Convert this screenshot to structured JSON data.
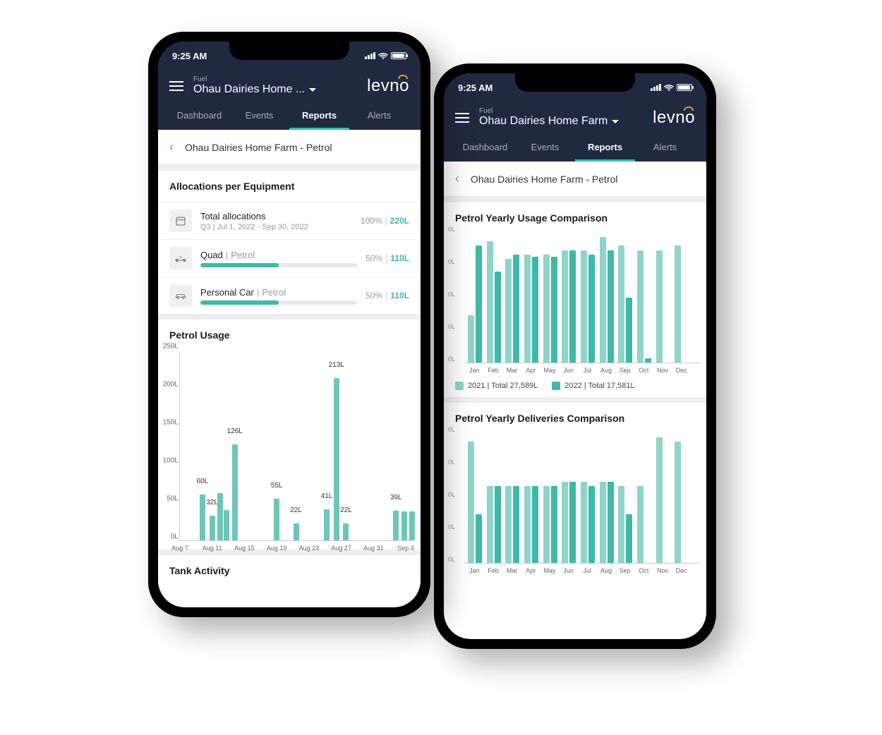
{
  "statusbar": {
    "time": "9:25 AM"
  },
  "header": {
    "subtitle": "Fuel",
    "title_short": "Ohau Dairies Home ...",
    "title_full": "Ohau Dairies Home Farm",
    "logo": "levno"
  },
  "tabs": [
    {
      "label": "Dashboard",
      "active": false
    },
    {
      "label": "Events",
      "active": false
    },
    {
      "label": "Reports",
      "active": true
    },
    {
      "label": "Alerts",
      "active": false
    }
  ],
  "breadcrumb": "Ohau Dairies Home Farm - Petrol",
  "allocations": {
    "section_title": "Allocations per Equipment",
    "rows": [
      {
        "icon": "calendar",
        "name": "Total allocations",
        "sub": "Q3 | Jul 1, 2022 - Sep 30, 2022",
        "pct": "100%",
        "vol": "220L",
        "has_bar": false
      },
      {
        "icon": "quad",
        "name": "Quad",
        "fuel": "Petrol",
        "pct": "50%",
        "vol": "110L",
        "fill": 50,
        "has_bar": true
      },
      {
        "icon": "car",
        "name": "Personal Car",
        "fuel": "Petrol",
        "pct": "50%",
        "vol": "110L",
        "fill": 50,
        "has_bar": true
      }
    ]
  },
  "usage_chart": {
    "title": "Petrol Usage",
    "tank_title": "Tank Activity"
  },
  "yearly_usage": {
    "title": "Petrol Yearly Usage Comparison",
    "legend_2021": "2021 | Total 27,589L",
    "legend_2022": "2022 | Total 17,581L"
  },
  "yearly_deliveries": {
    "title": "Petrol Yearly Deliveries Comparison"
  },
  "chart_data": [
    {
      "type": "bar",
      "title": "Petrol Usage",
      "ylabel": "L",
      "ylim": [
        0,
        250
      ],
      "yticks": [
        "0L",
        "50L",
        "100L",
        "150L",
        "200L",
        "250L"
      ],
      "categories": [
        "Aug 7",
        "Aug 11",
        "Aug 15",
        "Aug 19",
        "Aug 23",
        "Aug 27",
        "Aug 31",
        "Sep 4"
      ],
      "bars": [
        {
          "x_index": 0.7,
          "value": 60,
          "label": "60L"
        },
        {
          "x_index": 1.0,
          "value": 32,
          "label": "32L"
        },
        {
          "x_index": 1.25,
          "value": 62,
          "label": null
        },
        {
          "x_index": 1.45,
          "value": 40,
          "label": null
        },
        {
          "x_index": 1.7,
          "value": 126,
          "label": "126L"
        },
        {
          "x_index": 3.0,
          "value": 55,
          "label": "55L"
        },
        {
          "x_index": 3.6,
          "value": 22,
          "label": "22L"
        },
        {
          "x_index": 4.55,
          "value": 41,
          "label": "41L"
        },
        {
          "x_index": 4.85,
          "value": 213,
          "label": "213L"
        },
        {
          "x_index": 5.15,
          "value": 22,
          "label": "22L"
        },
        {
          "x_index": 6.7,
          "value": 39,
          "label": "39L"
        },
        {
          "x_index": 6.95,
          "value": 38,
          "label": null
        },
        {
          "x_index": 7.2,
          "value": 38,
          "label": null
        }
      ]
    },
    {
      "type": "bar",
      "title": "Petrol Yearly Usage Comparison",
      "categories": [
        "Jan",
        "Feb",
        "Mar",
        "Apr",
        "May",
        "Jun",
        "Jul",
        "Aug",
        "Sep",
        "Oct",
        "Nov",
        "Dec"
      ],
      "series": [
        {
          "name": "2021",
          "color": "#8ed4c9",
          "values": [
            1100,
            2800,
            2400,
            2500,
            2500,
            2600,
            2600,
            2900,
            2700,
            2600,
            2600,
            2700
          ]
        },
        {
          "name": "2022",
          "color": "#3eb8a7",
          "values": [
            2700,
            2100,
            2500,
            2450,
            2450,
            2600,
            2500,
            2600,
            1500,
            100,
            0,
            0
          ]
        }
      ],
      "ylim": [
        0,
        3000
      ]
    },
    {
      "type": "bar",
      "title": "Petrol Yearly Deliveries Comparison",
      "categories": [
        "Jan",
        "Feb",
        "Mar",
        "Apr",
        "May",
        "Jun",
        "Jul",
        "Aug",
        "Sep",
        "Oct",
        "Nov",
        "Dec"
      ],
      "series": [
        {
          "name": "2021",
          "color": "#8ed4c9",
          "values": [
            3000,
            1900,
            1900,
            1900,
            1900,
            2000,
            2000,
            2000,
            1900,
            1900,
            3100,
            3000
          ]
        },
        {
          "name": "2022",
          "color": "#3eb8a7",
          "values": [
            1200,
            1900,
            1900,
            1900,
            1900,
            2000,
            1900,
            2000,
            1200,
            0,
            0,
            0
          ]
        }
      ],
      "ylim": [
        0,
        3200
      ]
    }
  ]
}
